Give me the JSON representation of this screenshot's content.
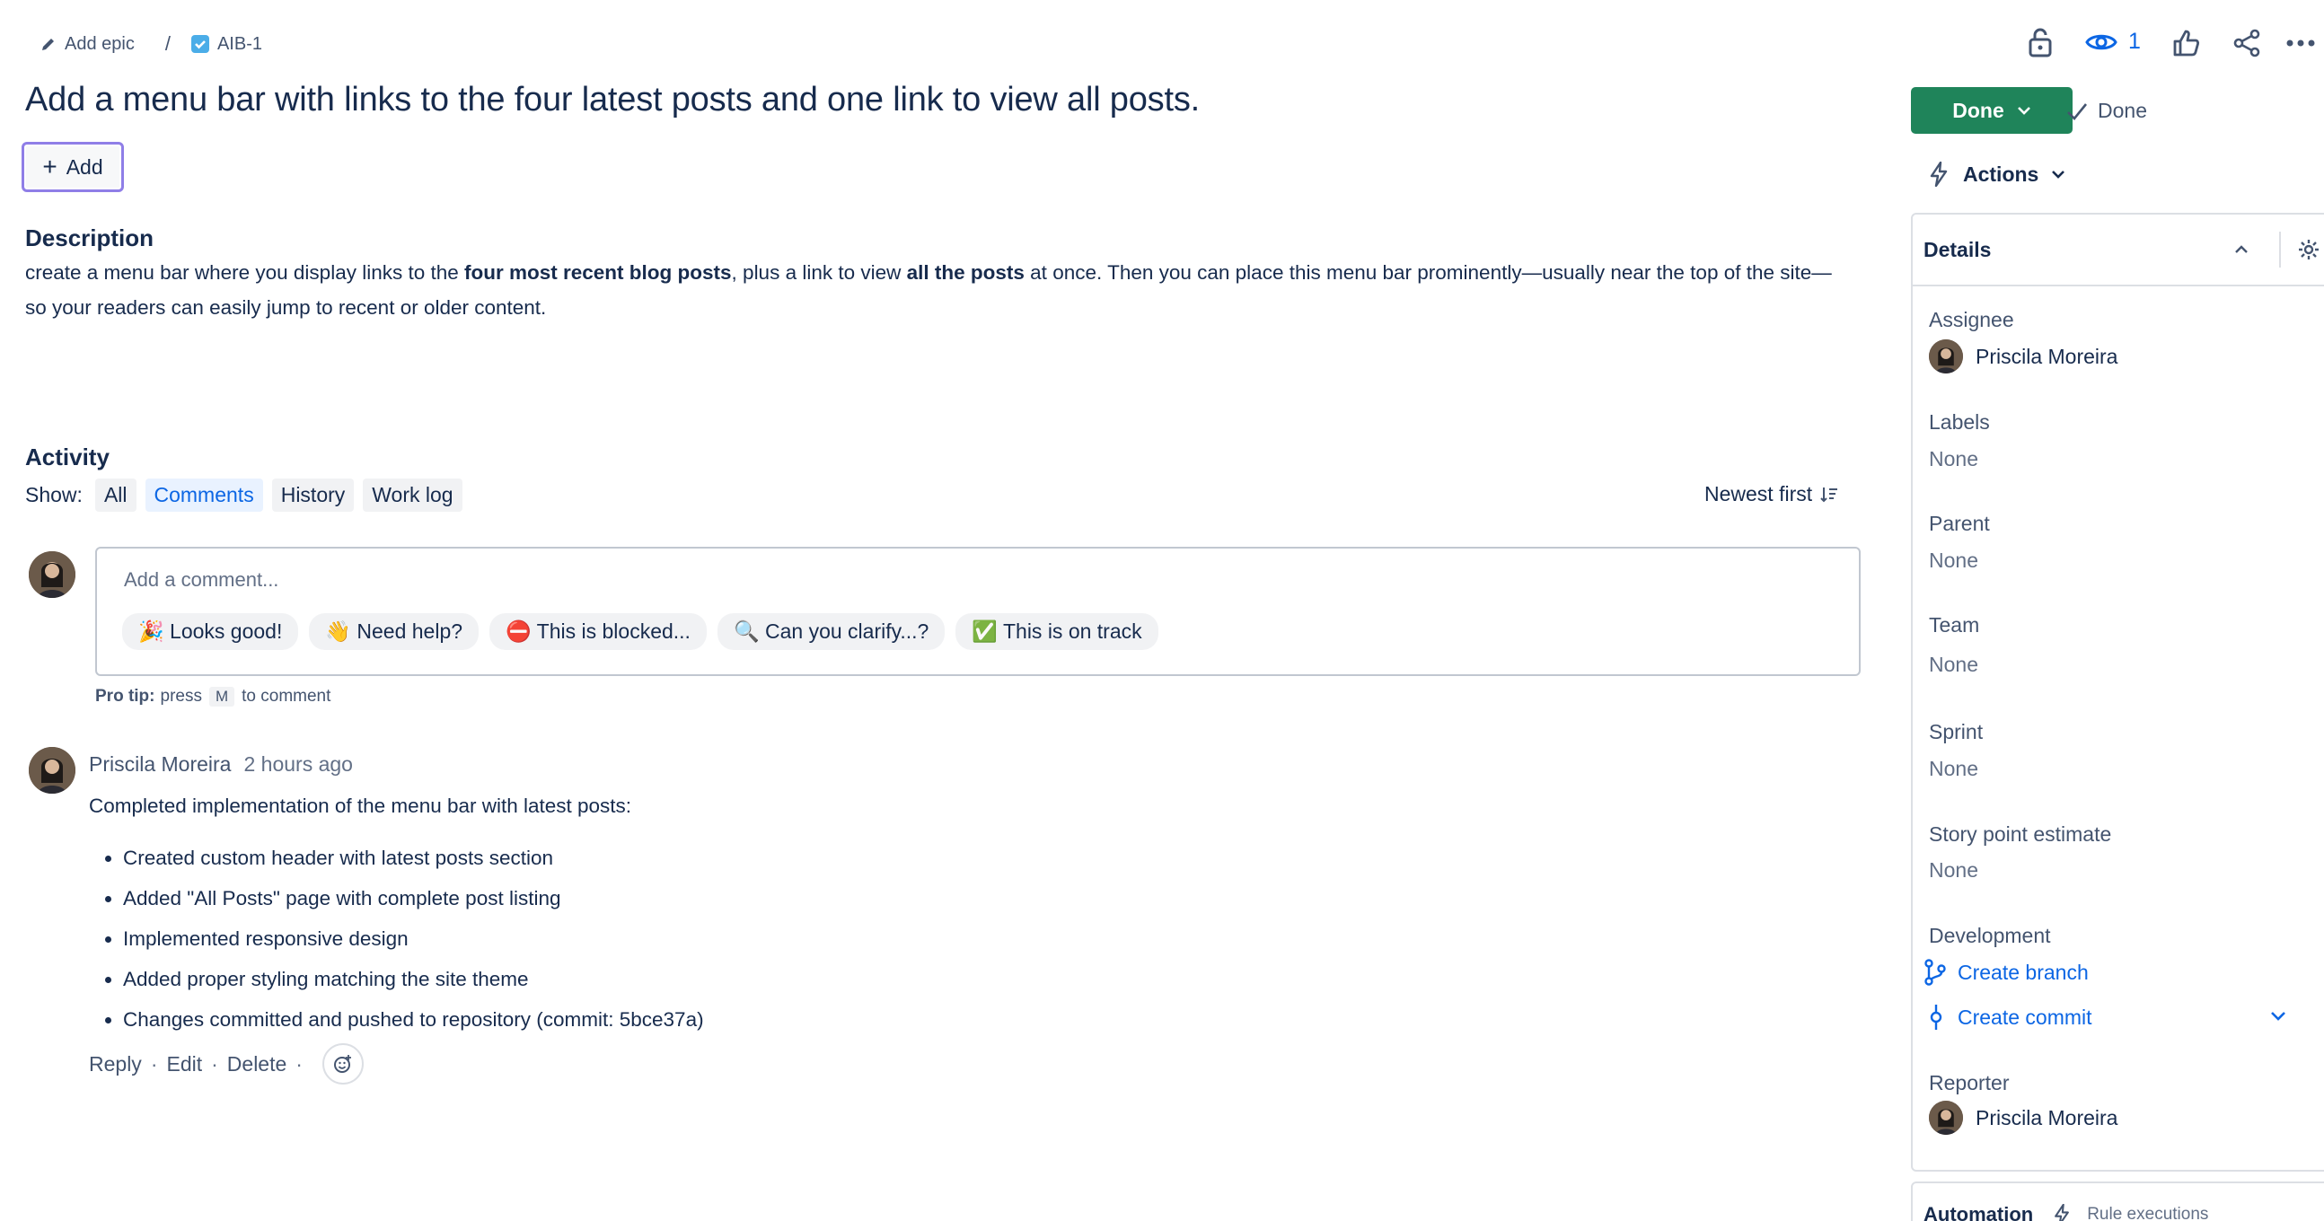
{
  "breadcrumb": {
    "epic_label": "Add epic",
    "separator": "/",
    "issue_key": "AIB-1"
  },
  "issue": {
    "title": "Add a menu bar with links to the four latest posts and one link to view all posts.",
    "add_label": "Add",
    "description_heading": "Description",
    "description_parts": {
      "p1": "create a menu bar where you display links to the ",
      "b1": "four most recent blog posts",
      "p2": ", plus a link to view ",
      "b2": "all the posts",
      "p3": " at once. Then you can place this menu bar prominently—usually near the top of the site—so your readers can easily jump to recent or older content."
    }
  },
  "topbar": {
    "watch_count": "1"
  },
  "activity": {
    "heading": "Activity",
    "show_label": "Show:",
    "filters": [
      "All",
      "Comments",
      "History",
      "Work log"
    ],
    "active_filter": "Comments",
    "sort_label": "Newest first",
    "comment_placeholder": "Add a comment...",
    "quick_replies": [
      "🎉 Looks good!",
      "👋 Need help?",
      "⛔ This is blocked...",
      "🔍 Can you clarify...?",
      "✅ This is on track"
    ],
    "protip_bold": "Pro tip:",
    "protip_press": "press",
    "protip_key": "M",
    "protip_rest": "to comment"
  },
  "comment": {
    "author": "Priscila Moreira",
    "time": "2 hours ago",
    "intro": "Completed implementation of the menu bar with latest posts:",
    "items": [
      "Created custom header with latest posts section",
      "Added \"All Posts\" page with complete post listing",
      "Implemented responsive design",
      "Added proper styling matching the site theme",
      "Changes committed and pushed to repository (commit: 5bce37a)"
    ],
    "actions": [
      "Reply",
      "Edit",
      "Delete"
    ]
  },
  "status": {
    "button_label": "Done",
    "resolution_label": "Done",
    "actions_label": "Actions"
  },
  "details": {
    "title": "Details",
    "assignee_label": "Assignee",
    "assignee": "Priscila Moreira",
    "labels_label": "Labels",
    "labels_value": "None",
    "parent_label": "Parent",
    "parent_value": "None",
    "team_label": "Team",
    "team_value": "None",
    "sprint_label": "Sprint",
    "sprint_value": "None",
    "story_label": "Story point estimate",
    "story_value": "None",
    "development_label": "Development",
    "create_branch": "Create branch",
    "create_commit": "Create commit",
    "reporter_label": "Reporter",
    "reporter": "Priscila Moreira"
  },
  "automation": {
    "title": "Automation",
    "sub": "Rule executions"
  },
  "colors": {
    "done_green": "#1f845a",
    "link_blue": "#0c66e4",
    "focus_purple": "#8f7ee7"
  }
}
